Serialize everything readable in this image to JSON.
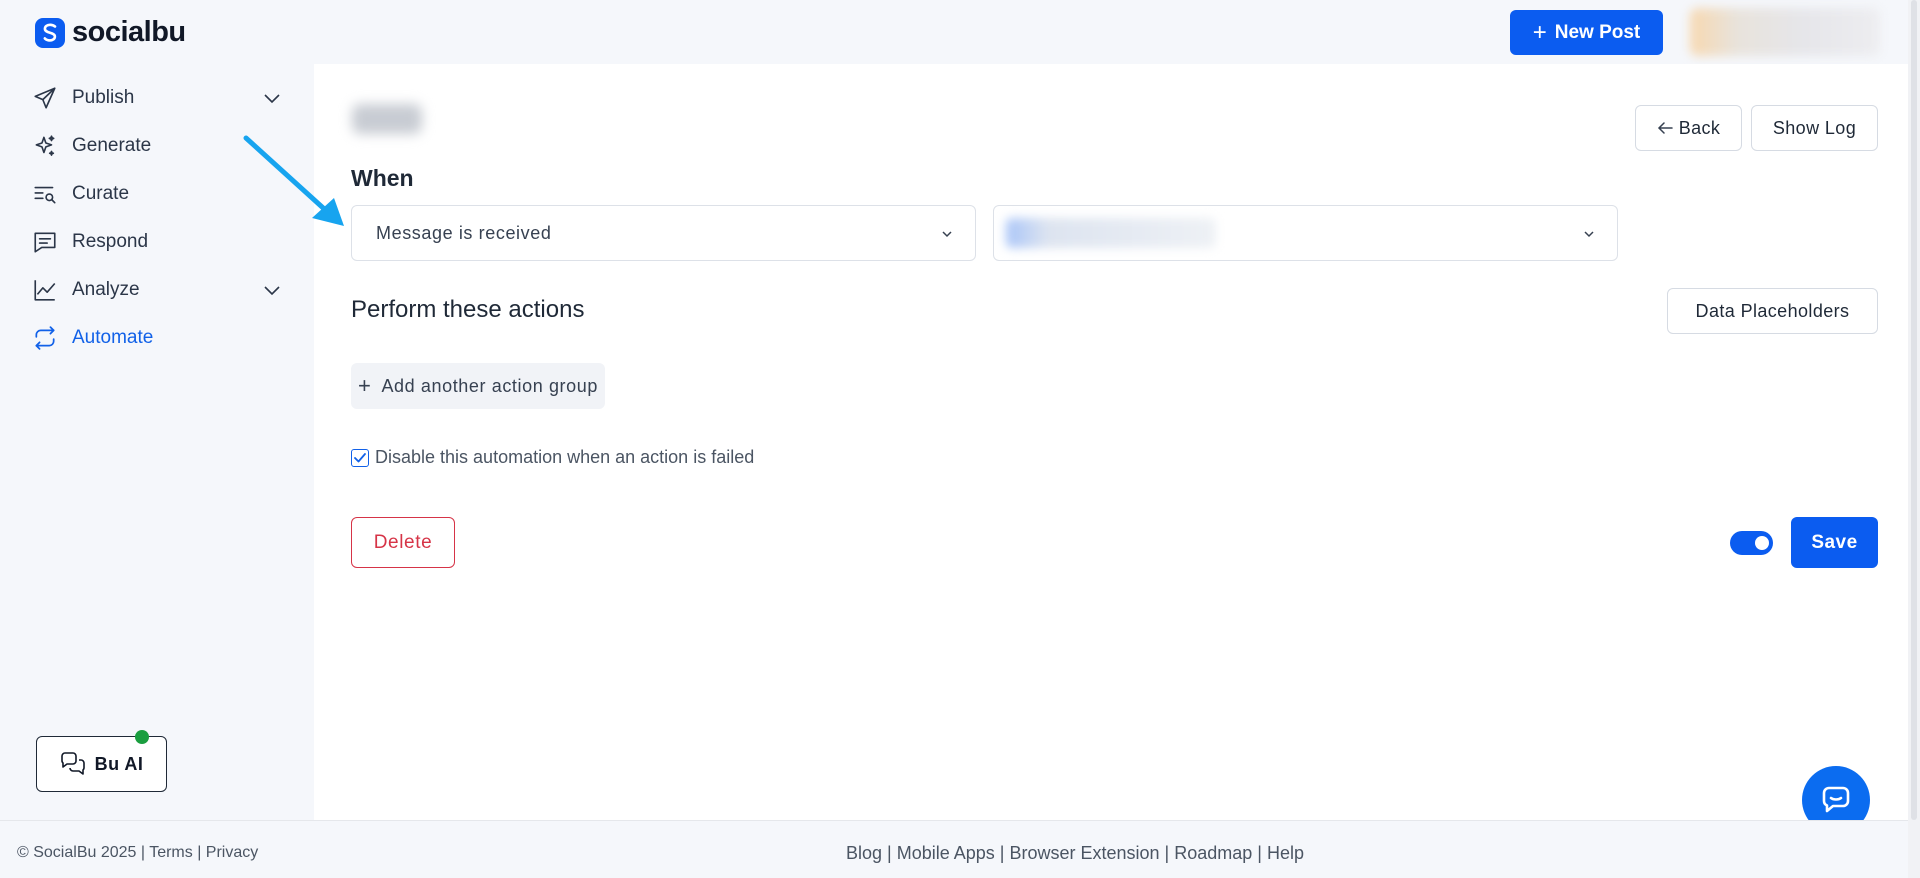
{
  "brand": {
    "name": "socialbu",
    "accent": "#0b5cf0"
  },
  "header": {
    "new_post_label": "New Post"
  },
  "sidebar": {
    "items": [
      {
        "label": "Publish",
        "icon": "send-icon",
        "has_chevron": true
      },
      {
        "label": "Generate",
        "icon": "sparkles-icon",
        "has_chevron": false
      },
      {
        "label": "Curate",
        "icon": "search-list-icon",
        "has_chevron": false
      },
      {
        "label": "Respond",
        "icon": "message-square-icon",
        "has_chevron": false
      },
      {
        "label": "Analyze",
        "icon": "line-chart-icon",
        "has_chevron": true
      },
      {
        "label": "Automate",
        "icon": "repeat-icon",
        "has_chevron": false,
        "active": true
      }
    ],
    "bu_ai_label": "Bu AI"
  },
  "main": {
    "back_label": "Back",
    "show_log_label": "Show Log",
    "when_title": "When",
    "trigger_select_value": "Message is received",
    "perform_title": "Perform these actions",
    "data_placeholders_label": "Data Placeholders",
    "add_group_label": "Add another action group",
    "disable_checkbox_label": "Disable this automation when an action is failed",
    "disable_checkbox_checked": true,
    "delete_label": "Delete",
    "save_label": "Save",
    "automation_enabled": true
  },
  "footer": {
    "copyright": "© SocialBu 2025",
    "left_links": [
      "Terms",
      "Privacy"
    ],
    "center_links": [
      "Blog",
      "Mobile Apps",
      "Browser Extension",
      "Roadmap",
      "Help"
    ]
  }
}
